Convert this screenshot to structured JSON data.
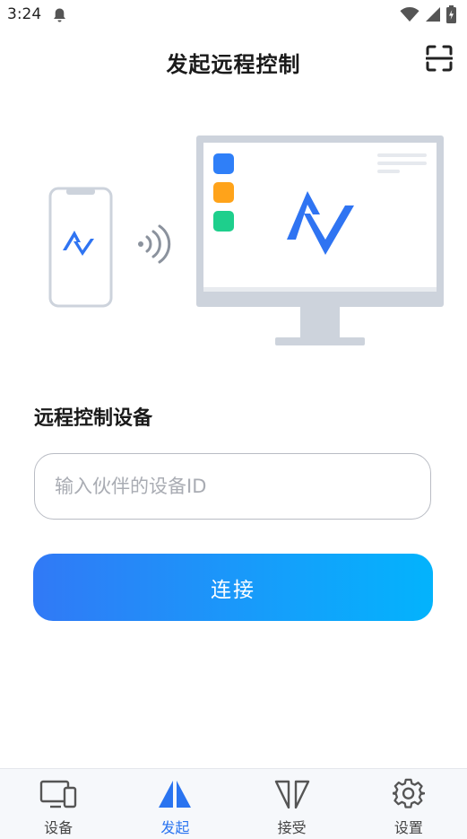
{
  "status_bar": {
    "time": "3:24",
    "icons": [
      "notification-bell-icon",
      "wifi-icon",
      "cell-signal-icon",
      "battery-charging-icon"
    ]
  },
  "header": {
    "title": "发起远程控制",
    "scan_icon": "scan-icon"
  },
  "illustration": {
    "icons": [
      "phone-icon",
      "signal-waves-icon",
      "monitor-icon",
      "app-logo-icon"
    ],
    "app_tile_colors": [
      "#2f7ff8",
      "#ffa31a",
      "#1ecf8c"
    ],
    "accent": "#2f74f2"
  },
  "form": {
    "section_label": "远程控制设备",
    "device_id": {
      "value": "",
      "placeholder": "输入伙伴的设备ID"
    },
    "connect_label": "连接"
  },
  "bottom_nav": {
    "active_index": 1,
    "active_color": "#2a74f0",
    "items": [
      {
        "label": "设备",
        "icon": "devices-icon"
      },
      {
        "label": "发起",
        "icon": "initiate-icon"
      },
      {
        "label": "接受",
        "icon": "accept-icon"
      },
      {
        "label": "设置",
        "icon": "settings-gear-icon"
      }
    ]
  }
}
